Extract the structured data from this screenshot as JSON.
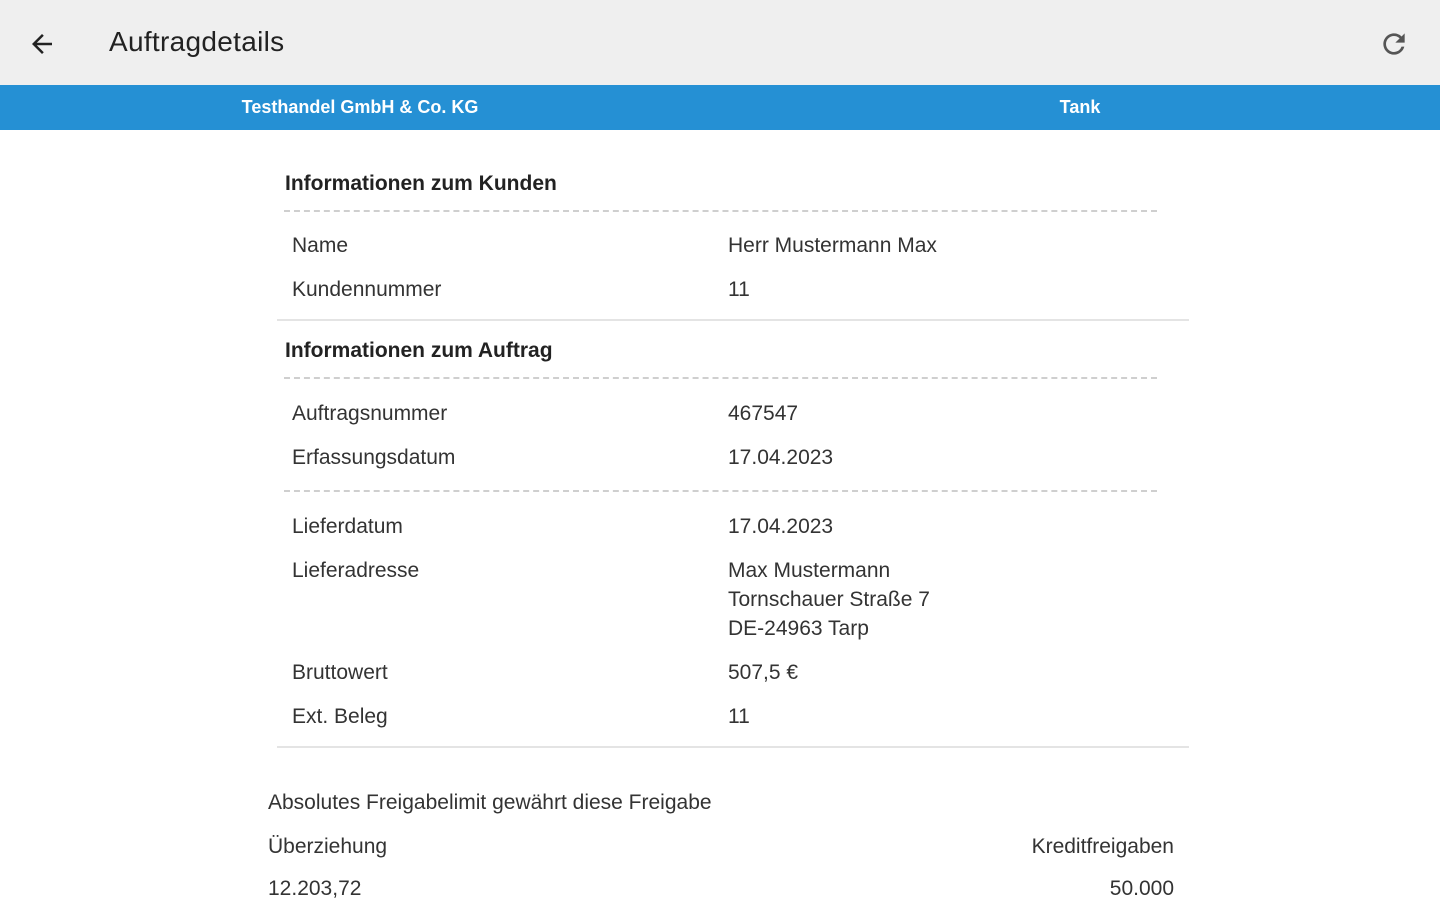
{
  "appbar": {
    "title": "Auftragdetails",
    "back_icon": "arrow-left-icon",
    "refresh_icon": "refresh-icon"
  },
  "tabs": [
    {
      "label": "Testhandel GmbH & Co. KG"
    },
    {
      "label": "Tank"
    }
  ],
  "customer": {
    "title": "Informationen zum Kunden",
    "rows": [
      {
        "label": "Name",
        "value": "Herr Mustermann Max"
      },
      {
        "label": "Kundennummer",
        "value": "11"
      }
    ]
  },
  "order": {
    "title": "Informationen zum Auftrag",
    "rows": [
      {
        "label": "Auftragsnummer",
        "value": "467547"
      },
      {
        "label": "Erfassungsdatum",
        "value": "17.04.2023"
      }
    ],
    "delivery_rows": [
      {
        "label": "Lieferdatum",
        "value": "17.04.2023"
      },
      {
        "label": "Lieferadresse",
        "value": "Max Mustermann\nTornschauer Straße 7\nDE-24963 Tarp"
      },
      {
        "label": "Bruttowert",
        "value": "507,5 €"
      },
      {
        "label": "Ext. Beleg",
        "value": "11"
      }
    ]
  },
  "approval": {
    "heading": "Absolutes Freigabelimit gewährt diese Freigabe",
    "left_label": "Überziehung",
    "right_label": "Kreditfreigaben",
    "left_value": "12.203,72",
    "right_value": "50.000"
  },
  "colors": {
    "appbar_bg": "#efefef",
    "tabbar_bg": "#2590d4"
  }
}
